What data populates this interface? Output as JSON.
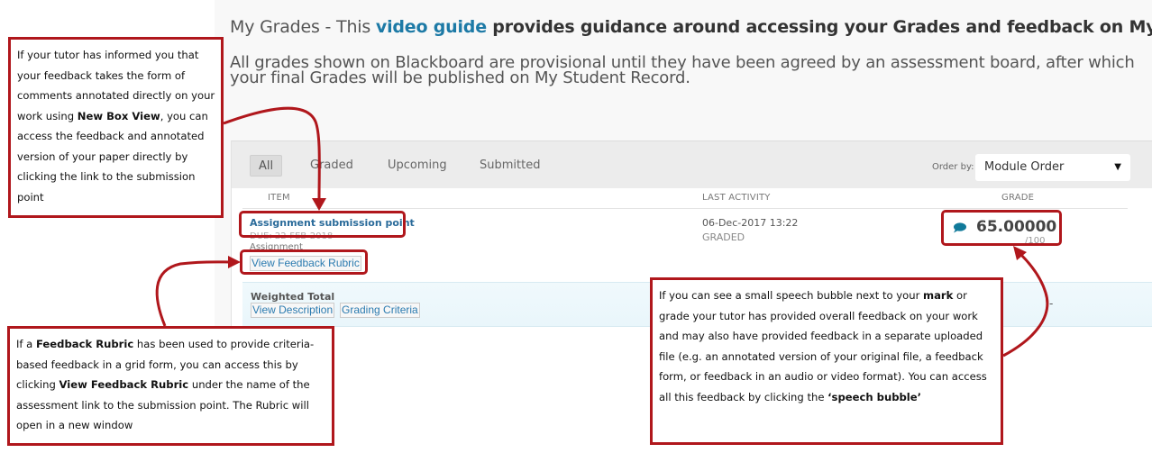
{
  "header": {
    "prefix": "My Grades - This ",
    "link": "video guide",
    "suffix": " provides guidance around accessing your Grades and feedback on My Grades.",
    "provisional_notice": "All grades shown on Blackboard are provisional until they have been agreed by an assessment board, after which your final Grades will be published on My Student Record."
  },
  "filters": {
    "tabs": [
      {
        "label": "All",
        "active": true
      },
      {
        "label": "Graded",
        "active": false
      },
      {
        "label": "Upcoming",
        "active": false
      },
      {
        "label": "Submitted",
        "active": false
      }
    ],
    "order_by_label": "Order by:",
    "order_by_value": "Module Order",
    "caret": "▼"
  },
  "columns": {
    "item": "ITEM",
    "last_activity": "LAST ACTIVITY",
    "grade": "GRADE"
  },
  "row": {
    "title": "Assignment submission point",
    "due": "DUE: 22-FEB-2018",
    "type": "Assignment",
    "rubric_link": "View Feedback Rubric",
    "last_activity_date": "06-Dec-2017 13:22",
    "status": "GRADED",
    "grade": "65.00000",
    "grade_max": "/100",
    "feedback_icon": "speech-bubble-icon"
  },
  "weighted_total": {
    "title": "Weighted Total",
    "view_description": "View Description",
    "grading_criteria": "Grading Criteria",
    "value": "-"
  },
  "callouts": {
    "box_view": {
      "p1": "If your tutor has informed you that your feedback takes the form of comments annotated directly on your work using ",
      "b1": "New Box View",
      "p2": ", you can access the feedback and annotated version of your paper directly by clicking the link to the submission point"
    },
    "rubric": {
      "p1": "If a ",
      "b1": "Feedback Rubric",
      "p2": " has been used to provide criteria-based feedback in a grid form, you can access this by clicking ",
      "b2": "View Feedback Rubric",
      "p3": " under the name of the assessment  link to the submission point.  The Rubric will open in a new window"
    },
    "speech_bubble": {
      "p1": "If you can see a small speech bubble next to your ",
      "b1": "mark",
      "p2": " or grade your tutor has provided overall feedback on your work and may also have provided feedback in a separate uploaded file (e.g. an annotated version of your original file, a feedback form, or feedback in an audio or video format). You can access all this feedback by clicking the ",
      "b2": "‘speech bubble’"
    }
  },
  "colors": {
    "annotation_red": "#b0171c",
    "link_blue": "#1d7aa6",
    "bubble_teal": "#107a9a"
  }
}
